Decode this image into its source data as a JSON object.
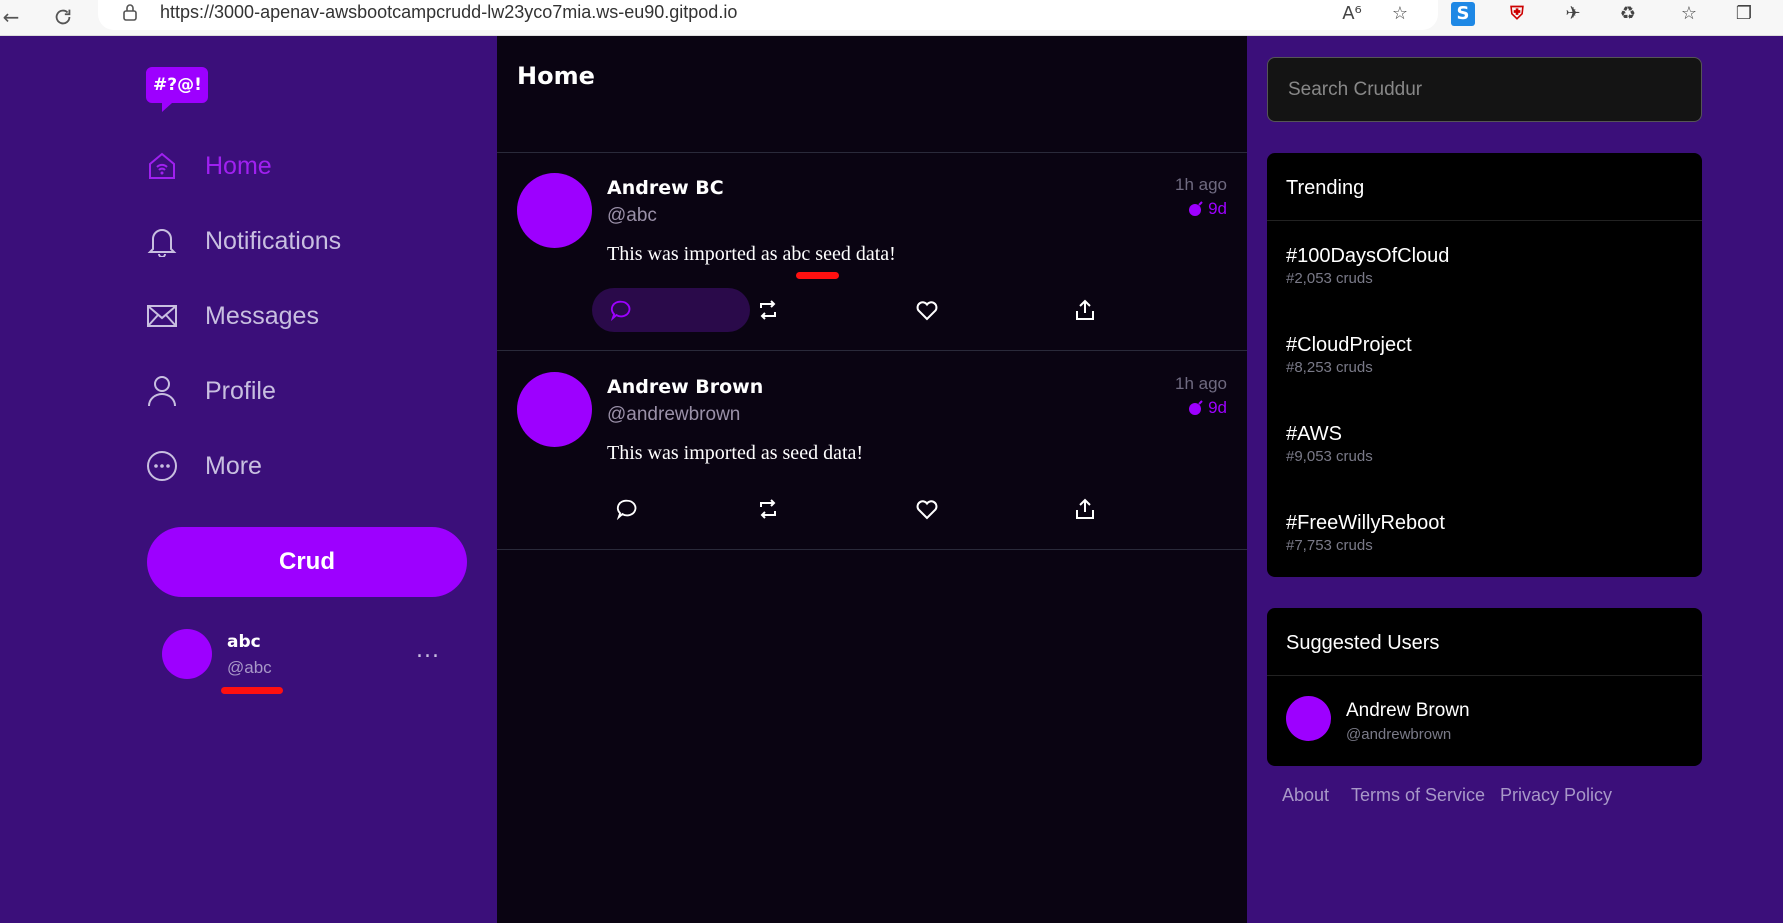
{
  "browser": {
    "url": "https://3000-apenav-awsbootcampcrudd-lw23yco7mia.ws-eu90.gitpod.io"
  },
  "logo_text": "#?@!",
  "sidebar": {
    "items": [
      {
        "label": "Home",
        "icon": "home-icon",
        "active": true
      },
      {
        "label": "Notifications",
        "icon": "bell-icon",
        "active": false
      },
      {
        "label": "Messages",
        "icon": "envelope-icon",
        "active": false
      },
      {
        "label": "Profile",
        "icon": "person-icon",
        "active": false
      },
      {
        "label": "More",
        "icon": "more-circle-icon",
        "active": false
      }
    ],
    "crud_button": "Crud",
    "profile": {
      "name": "abc",
      "handle": "@abc",
      "more": "..."
    }
  },
  "feed": {
    "title": "Home",
    "activities": [
      {
        "name": "Andrew BC",
        "handle": "@abc",
        "time": "1h ago",
        "expires": "9d",
        "message": "This was imported as abc seed data!"
      },
      {
        "name": "Andrew Brown",
        "handle": "@andrewbrown",
        "time": "1h ago",
        "expires": "9d",
        "message": "This was imported as seed data!"
      }
    ]
  },
  "search": {
    "placeholder": "Search Cruddur"
  },
  "trending": {
    "title": "Trending",
    "items": [
      {
        "tag": "#100DaysOfCloud",
        "count": "#2,053 cruds"
      },
      {
        "tag": "#CloudProject",
        "count": "#8,253 cruds"
      },
      {
        "tag": "#AWS",
        "count": "#9,053 cruds"
      },
      {
        "tag": "#FreeWillyReboot",
        "count": "#7,753 cruds"
      }
    ]
  },
  "suggested": {
    "title": "Suggested Users",
    "users": [
      {
        "name": "Andrew Brown",
        "handle": "@andrewbrown"
      }
    ]
  },
  "footer": {
    "about": "About",
    "terms": "Terms of Service",
    "privacy": "Privacy Policy"
  },
  "colors": {
    "accent": "#9d00ff",
    "sidebar_bg": "#3b0f7a",
    "feed_bg": "#0a0412",
    "highlight_mark": "#ff1010"
  }
}
